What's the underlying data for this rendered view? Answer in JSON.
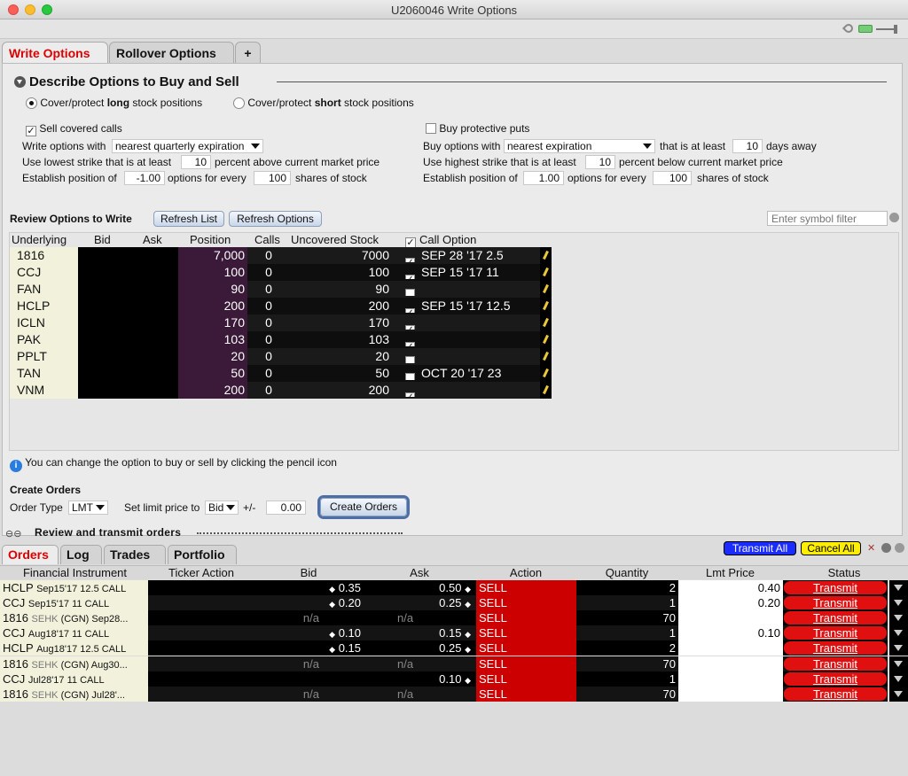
{
  "window": {
    "title": "U2060046 Write Options"
  },
  "tabs": [
    {
      "label": "Write Options"
    },
    {
      "label": "Rollover Options"
    },
    {
      "label": "+"
    }
  ],
  "describe": {
    "title": "Describe Options to Buy and Sell",
    "radio_long": {
      "pre": "Cover/protect ",
      "bold": "long",
      "post": " stock positions"
    },
    "radio_short": {
      "pre": "Cover/protect ",
      "bold": "short",
      "post": " stock positions"
    },
    "left": {
      "sell_covered": "Sell covered calls",
      "write_with": "Write options with",
      "write_select": "nearest quarterly expiration",
      "lowest_strike": "Use lowest strike that is at least",
      "lowest_value": "10",
      "lowest_suffix": "percent above current market price",
      "establish": "Establish position of",
      "establish_value": "-1.00",
      "options_for_every": "options for every",
      "shares_value": "100",
      "shares_of_stock": "shares of stock"
    },
    "right": {
      "buy_puts": "Buy protective puts",
      "buy_with": "Buy options with",
      "buy_select": "nearest expiration",
      "that_is": "that is at least",
      "days_value": "10",
      "days_away": "days away",
      "highest_strike": "Use highest strike that is at least",
      "highest_value": "10",
      "highest_suffix": "percent below current market price",
      "establish": "Establish position of",
      "establish_value": "1.00",
      "options_for_every": "options for every",
      "shares_value": "100",
      "shares_of_stock": "shares of stock"
    }
  },
  "review": {
    "label": "Review Options to Write",
    "refresh_list": "Refresh List",
    "refresh_options": "Refresh Options",
    "filter_placeholder": "Enter symbol filter",
    "headers": {
      "underlying": "Underlying",
      "bid": "Bid",
      "ask": "Ask",
      "position": "Position",
      "calls": "Calls",
      "uncovered": "Uncovered Stock",
      "call_option": "Call Option"
    },
    "rows": [
      {
        "underlying": "1816",
        "position": "7,000",
        "calls": "0",
        "uncovered": "7000",
        "checked": true,
        "option": "SEP 28 '17 2.5"
      },
      {
        "underlying": "CCJ",
        "position": "100",
        "calls": "0",
        "uncovered": "100",
        "checked": true,
        "option": "SEP 15 '17 11"
      },
      {
        "underlying": "FAN",
        "position": "90",
        "calls": "0",
        "uncovered": "90",
        "checked": false,
        "option": ""
      },
      {
        "underlying": "HCLP",
        "position": "200",
        "calls": "0",
        "uncovered": "200",
        "checked": true,
        "option": "SEP 15 '17 12.5"
      },
      {
        "underlying": "ICLN",
        "position": "170",
        "calls": "0",
        "uncovered": "170",
        "checked": true,
        "option": ""
      },
      {
        "underlying": "PAK",
        "position": "103",
        "calls": "0",
        "uncovered": "103",
        "checked": true,
        "option": ""
      },
      {
        "underlying": "PPLT",
        "position": "20",
        "calls": "0",
        "uncovered": "20",
        "checked": false,
        "option": ""
      },
      {
        "underlying": "TAN",
        "position": "50",
        "calls": "0",
        "uncovered": "50",
        "checked": false,
        "option": "OCT 20 '17 23"
      },
      {
        "underlying": "VNM",
        "position": "200",
        "calls": "0",
        "uncovered": "200",
        "checked": true,
        "option": ""
      }
    ],
    "info": "You can change the option to buy or sell by clicking the pencil icon"
  },
  "create": {
    "title": "Create Orders",
    "order_type_label": "Order Type",
    "order_type": "LMT",
    "limit_label": "Set limit price to",
    "limit_select": "Bid",
    "plusminus": "+/-",
    "offset": "0.00",
    "button": "Create Orders"
  },
  "transmit_section": {
    "label": "Review and transmit orders"
  },
  "orders": {
    "tabs": [
      "Orders",
      "Log",
      "Trades",
      "Portfolio"
    ],
    "transmit_all": "Transmit All",
    "cancel_all": "Cancel All",
    "headers": {
      "instrument": "Financial Instrument",
      "ticker": "Ticker Action",
      "bid": "Bid",
      "ask": "Ask",
      "action": "Action",
      "quantity": "Quantity",
      "lmt": "Lmt Price",
      "status": "Status"
    },
    "rows": [
      {
        "sym": "HCLP",
        "desc": "Sep15'17 12.5 CALL",
        "ex": "",
        "bid": "0.35",
        "ask": "0.50",
        "action": "SELL",
        "qty": "2",
        "lmt": "0.40",
        "status": "Transmit"
      },
      {
        "sym": "CCJ",
        "desc": "Sep15'17 11 CALL",
        "ex": "",
        "bid": "0.20",
        "ask": "0.25",
        "action": "SELL",
        "qty": "1",
        "lmt": "0.20",
        "status": "Transmit"
      },
      {
        "sym": "1816",
        "desc": " (CGN) Sep28...",
        "ex": "SEHK",
        "bid": "n/a",
        "ask": "n/a",
        "action": "SELL",
        "qty": "70",
        "lmt": "",
        "status": "Transmit"
      },
      {
        "sym": "CCJ",
        "desc": "Aug18'17 11 CALL",
        "ex": "",
        "bid": "0.10",
        "ask": "0.15",
        "action": "SELL",
        "qty": "1",
        "lmt": "0.10",
        "status": "Transmit"
      },
      {
        "sym": "HCLP",
        "desc": "Aug18'17 12.5 CALL",
        "ex": "",
        "bid": "0.15",
        "ask": "0.25",
        "action": "SELL",
        "qty": "2",
        "lmt": "",
        "status": "Transmit"
      },
      {
        "sym": "1816",
        "desc": " (CGN) Aug30...",
        "ex": "SEHK",
        "bid": "n/a",
        "ask": "n/a",
        "action": "SELL",
        "qty": "70",
        "lmt": "",
        "status": "Transmit"
      },
      {
        "sym": "CCJ",
        "desc": "Jul28'17 11 CALL",
        "ex": "",
        "bid": "",
        "ask": "0.10",
        "action": "SELL",
        "qty": "1",
        "lmt": "",
        "status": "Transmit"
      },
      {
        "sym": "1816",
        "desc": " (CGN) Jul28'...",
        "ex": "SEHK",
        "bid": "n/a",
        "ask": "n/a",
        "action": "SELL",
        "qty": "70",
        "lmt": "",
        "status": "Transmit"
      }
    ]
  },
  "colors": {
    "accent_red": "#d00000",
    "sell_red": "#cc0000",
    "transmit_red": "#e01010",
    "position_purple": "#3a1a38",
    "transmit_all_blue": "#1a2cff",
    "cancel_all_yellow": "#ffee00"
  }
}
